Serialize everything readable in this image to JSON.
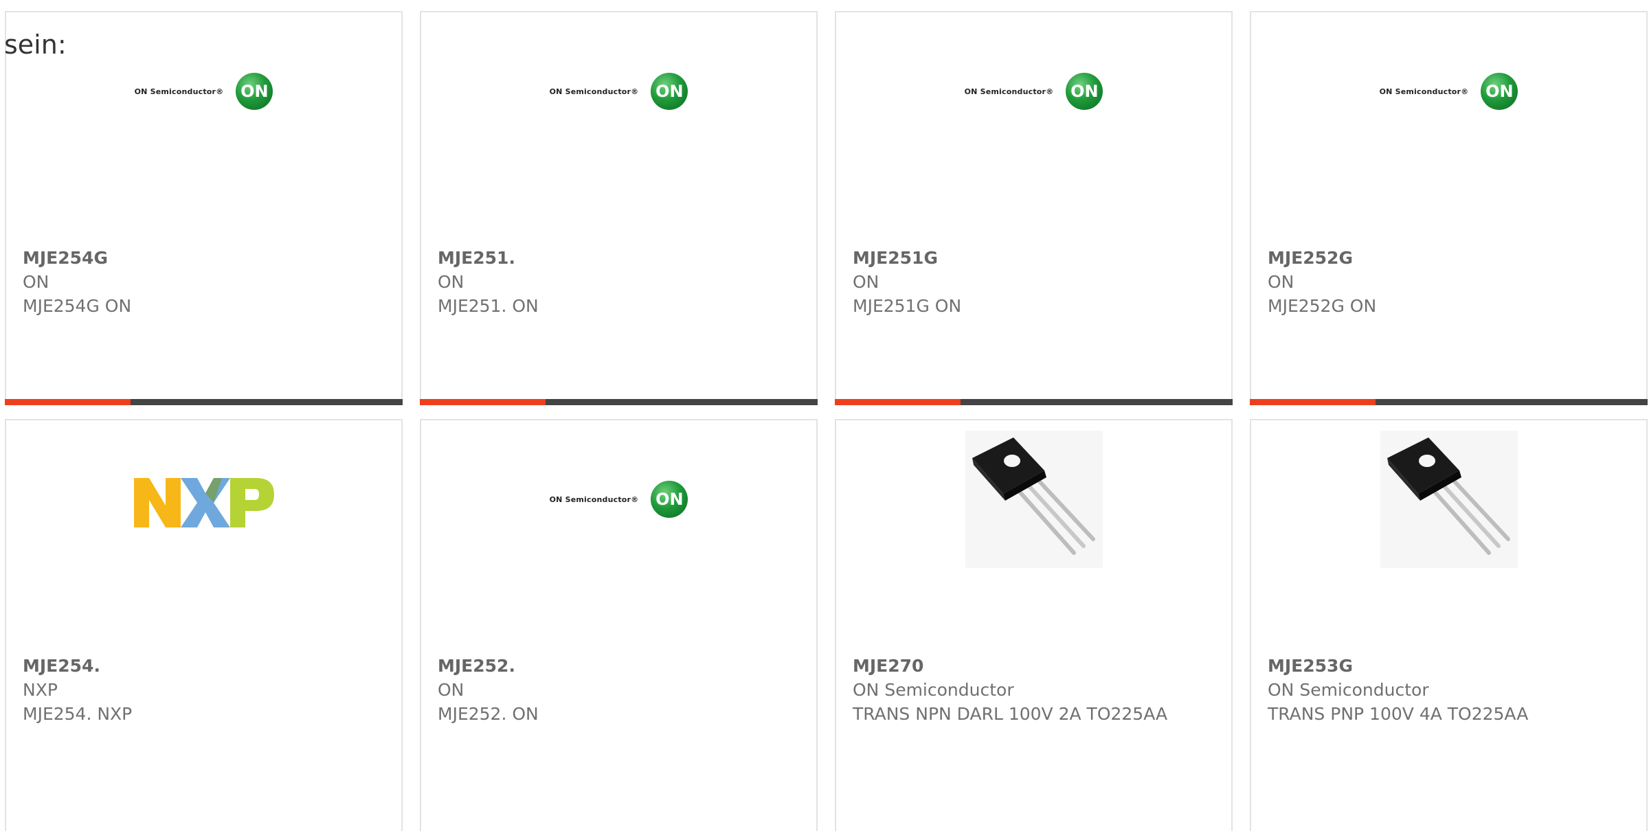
{
  "page_text": "sein:",
  "products": [
    {
      "title": "MJE254G",
      "maker": "ON",
      "desc": "MJE254G ON",
      "image": "on-semiconductor-logo",
      "logo_wordmark": "ON Semiconductor®",
      "logo_mark": "ON"
    },
    {
      "title": "MJE251.",
      "maker": "ON",
      "desc": "MJE251. ON",
      "image": "on-semiconductor-logo",
      "logo_wordmark": "ON Semiconductor®",
      "logo_mark": "ON"
    },
    {
      "title": "MJE251G",
      "maker": "ON",
      "desc": "MJE251G ON",
      "image": "on-semiconductor-logo",
      "logo_wordmark": "ON Semiconductor®",
      "logo_mark": "ON"
    },
    {
      "title": "MJE252G",
      "maker": "ON",
      "desc": "MJE252G ON",
      "image": "on-semiconductor-logo",
      "logo_wordmark": "ON Semiconductor®",
      "logo_mark": "ON"
    },
    {
      "title": "MJE254.",
      "maker": "NXP",
      "desc": "MJE254. NXP",
      "image": "nxp-logo"
    },
    {
      "title": "MJE252.",
      "maker": "ON",
      "desc": "MJE252. ON",
      "image": "on-semiconductor-logo",
      "logo_wordmark": "ON Semiconductor®",
      "logo_mark": "ON"
    },
    {
      "title": "MJE270",
      "maker": "ON Semiconductor",
      "desc": "TRANS NPN DARL 100V 2A TO225AA",
      "image": "transistor-photo"
    },
    {
      "title": "MJE253G",
      "maker": "ON Semiconductor",
      "desc": "TRANS PNP 100V 4A TO225AA",
      "image": "transistor-photo"
    }
  ],
  "colors": {
    "accent": "#ee3f1c",
    "bar": "#444444",
    "border": "#e3e3e3",
    "text": "#707070",
    "on_green": "#1f9a3a",
    "nxp_yellow": "#f7b718",
    "nxp_blue": "#6fa8dc",
    "nxp_green": "#b5d334"
  }
}
